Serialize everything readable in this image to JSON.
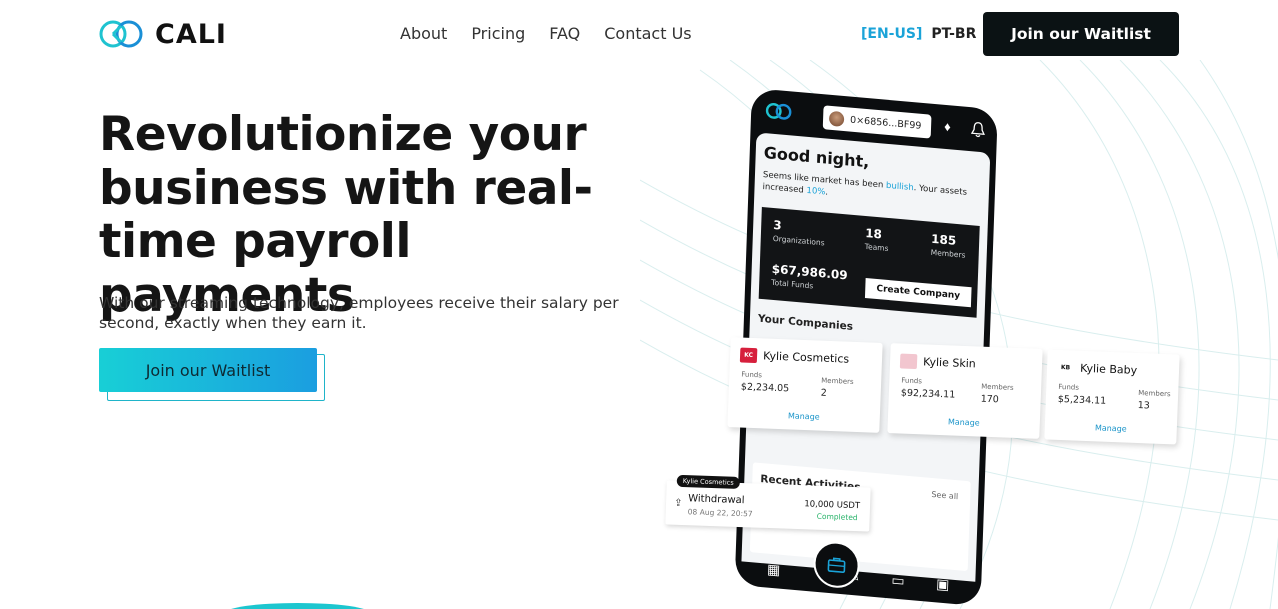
{
  "brand": {
    "name": "CALI",
    "accent": "#1aa3d8",
    "gradient_start": "#18cfd6",
    "gradient_end": "#1b9ee0"
  },
  "nav": {
    "items": [
      "About",
      "Pricing",
      "FAQ",
      "Contact Us"
    ]
  },
  "lang": {
    "active": "[EN-US]",
    "other": "PT-BR"
  },
  "header": {
    "cta_label": "Join our Waitlist"
  },
  "hero": {
    "title": "Revolutionize your business with real-time payroll payments",
    "subtitle": "With our streaming technology, employees receive their salary per second, exactly when they earn it.",
    "cta_label": "Join our Waitlist"
  },
  "app": {
    "wallet": "0×6856...BF99",
    "greeting": "Good night,",
    "market_prefix": "Seems like market has been ",
    "market_word": "bullish",
    "market_mid": ". Your assets increased ",
    "market_pct": "10%",
    "market_end": ".",
    "stats": {
      "orgs_value": "3",
      "orgs_label": "Organizations",
      "teams_value": "18",
      "teams_label": "Teams",
      "members_value": "185",
      "members_label": "Members",
      "funds_value": "$67,986.09",
      "funds_label": "Total Funds",
      "create_label": "Create Company"
    },
    "companies_title": "Your Companies",
    "companies": [
      {
        "name": "Kylie Cosmetics",
        "funds_label": "Funds",
        "funds": "$2,234.05",
        "members_label": "Members",
        "members": "2",
        "manage": "Manage",
        "logo": "KC",
        "logo_color": "#d61f3c"
      },
      {
        "name": "Kylie Skin",
        "funds_label": "Funds",
        "funds": "$92,234.11",
        "members_label": "Members",
        "members": "170",
        "manage": "Manage",
        "logo": "",
        "logo_color": "#f2c6cf"
      },
      {
        "name": "Kylie Baby",
        "funds_label": "Funds",
        "funds": "$5,234.11",
        "members_label": "Members",
        "members": "13",
        "manage": "Manage",
        "logo": "KB",
        "logo_color": "#ffffff"
      }
    ],
    "recent_title": "Recent Activities",
    "see_all": "See all",
    "activity": {
      "tag": "Kylie Cosmetics",
      "type": "Withdrawal",
      "date": "08 Aug 22, 20:57",
      "amount": "10,000 USDT",
      "status": "Completed"
    },
    "nav_icons": [
      "grid-icon",
      "briefcase-icon",
      "edit-icon",
      "folder-icon",
      "card-icon"
    ]
  }
}
